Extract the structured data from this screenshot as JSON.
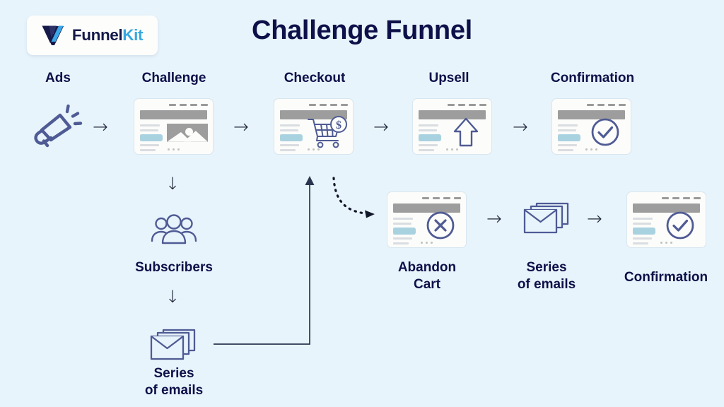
{
  "page": {
    "title": "Challenge Funnel",
    "background_color": "#e8f4fb",
    "title_color": "#0d1049",
    "accent_color": "#4f5b94"
  },
  "logo": {
    "name": "FunnelKit",
    "text_dark": "Funnel",
    "text_blue": "Kit",
    "mark_icon": "funnelkit-v-mark-icon",
    "dark_color": "#151a4a",
    "blue_color": "#35a8e0"
  },
  "top_row": {
    "nodes": [
      {
        "label": "Ads",
        "icon": "megaphone-icon",
        "type": "icon"
      },
      {
        "label": "Challenge",
        "icon": "landing-page-icon",
        "type": "card"
      },
      {
        "label": "Checkout",
        "icon": "shopping-cart-icon",
        "type": "card"
      },
      {
        "label": "Upsell",
        "icon": "up-arrow-icon",
        "type": "card"
      },
      {
        "label": "Confirmation",
        "icon": "check-circle-icon",
        "type": "card"
      }
    ],
    "connector": "→"
  },
  "left_branch": {
    "nodes": [
      {
        "label": "Subscribers",
        "icon": "people-group-icon"
      },
      {
        "label": "Series\nof emails",
        "icon": "stacked-envelopes-icon"
      }
    ],
    "connector": "↓"
  },
  "bottom_row": {
    "nodes": [
      {
        "label": "Abandon\nCart",
        "icon": "x-circle-icon",
        "type": "card"
      },
      {
        "label": "Series\nof emails",
        "icon": "stacked-envelopes-icon",
        "type": "icon"
      },
      {
        "label": "Confirmation",
        "icon": "check-circle-icon",
        "type": "card"
      }
    ],
    "connector": "→"
  },
  "connectors": {
    "abandon_branch": {
      "style": "dashed-curve",
      "from": "Checkout",
      "to": "Abandon Cart"
    },
    "feedback_loop": {
      "style": "solid-elbow",
      "from": "Series of emails",
      "to": "Checkout"
    }
  }
}
